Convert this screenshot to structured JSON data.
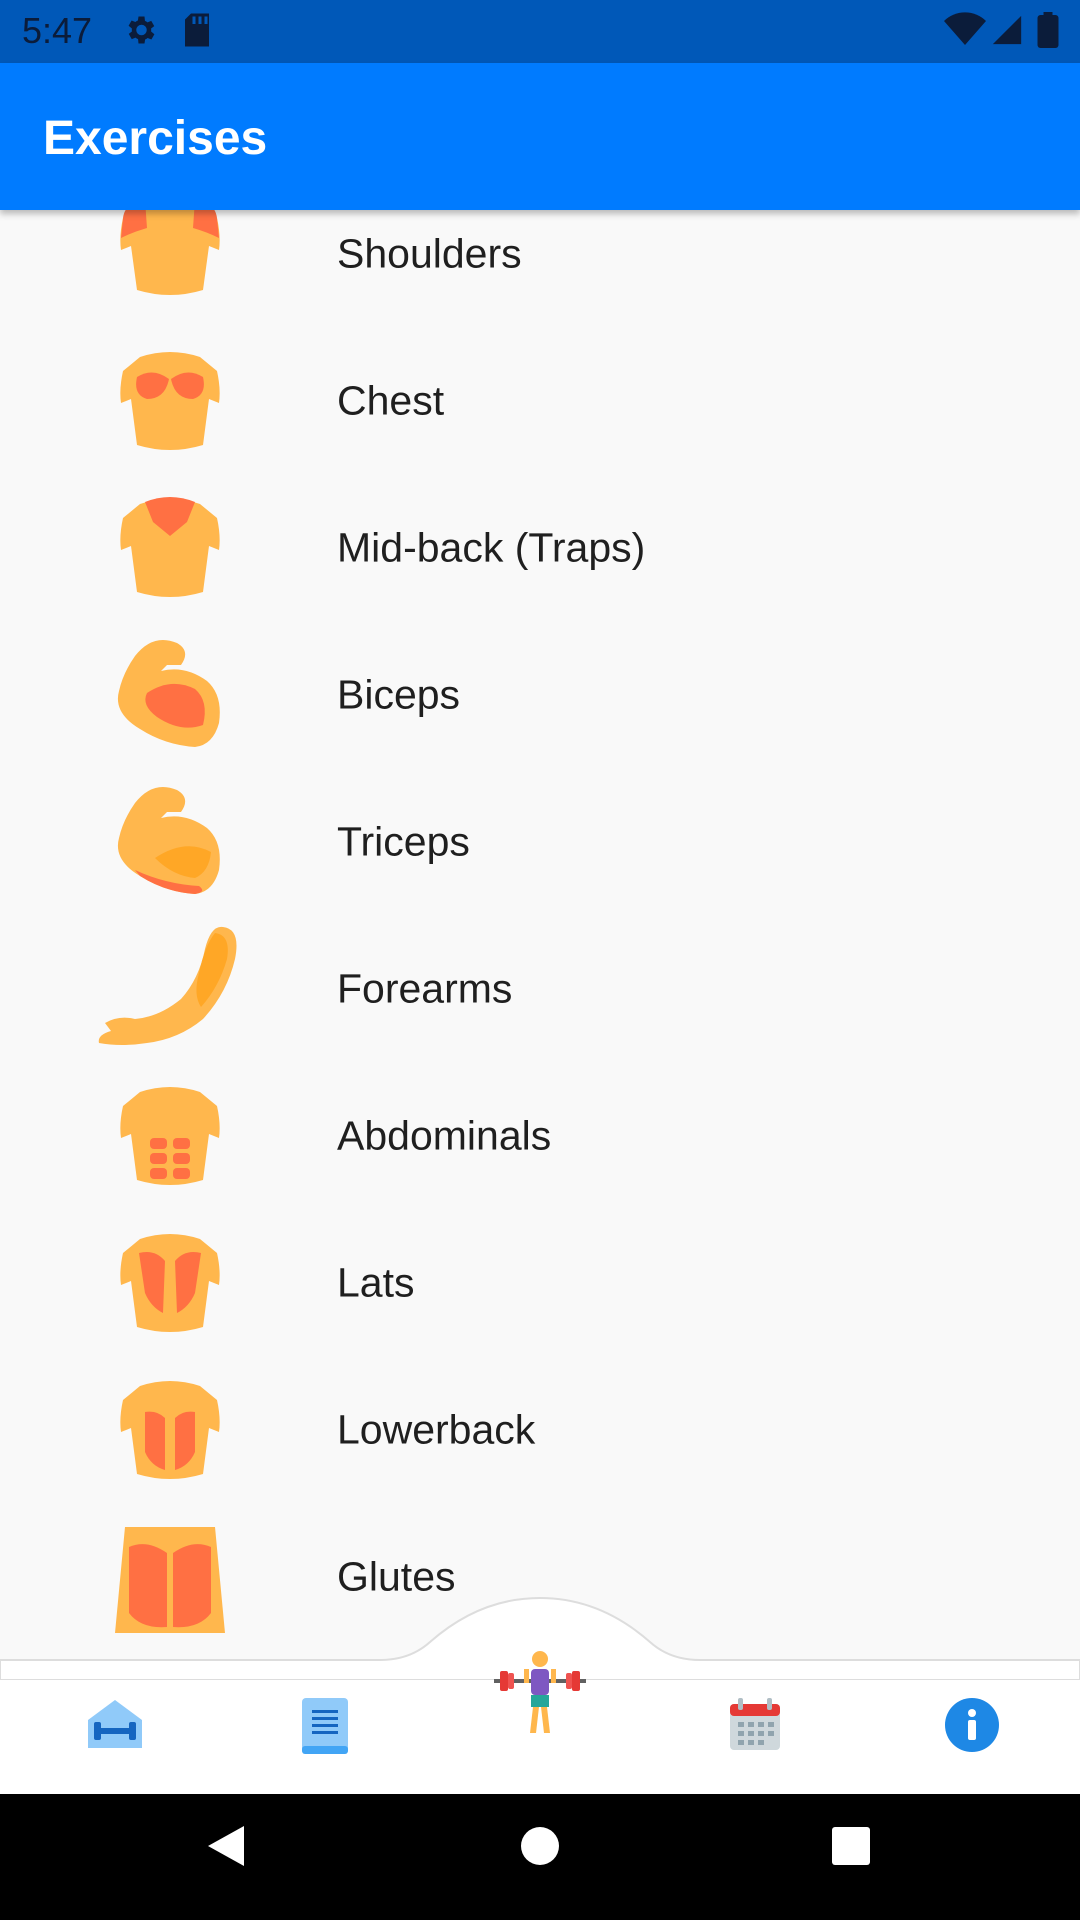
{
  "status_bar": {
    "time": "5:47",
    "icons": [
      "gear-icon",
      "sd-card-icon",
      "wifi-icon",
      "signal-icon",
      "battery-icon"
    ]
  },
  "app_bar": {
    "title": "Exercises"
  },
  "exercises": [
    {
      "label": "Shoulders",
      "icon": "shoulders-icon"
    },
    {
      "label": "Chest",
      "icon": "chest-icon"
    },
    {
      "label": "Mid-back (Traps)",
      "icon": "traps-icon"
    },
    {
      "label": "Biceps",
      "icon": "biceps-icon"
    },
    {
      "label": "Triceps",
      "icon": "triceps-icon"
    },
    {
      "label": "Forearms",
      "icon": "forearm-icon"
    },
    {
      "label": "Abdominals",
      "icon": "abs-icon"
    },
    {
      "label": "Lats",
      "icon": "lats-icon"
    },
    {
      "label": "Lowerback",
      "icon": "lowerback-icon"
    },
    {
      "label": "Glutes",
      "icon": "glutes-icon"
    }
  ],
  "bottom_nav": {
    "items": [
      "home-gym-icon",
      "notes-list-icon",
      "weightlifter-icon",
      "calendar-icon",
      "info-icon"
    ],
    "active": "weightlifter-icon"
  },
  "colors": {
    "status_bar": "#0058b8",
    "app_bar": "#007bff",
    "skin": "#ffb74d",
    "muscle": "#ff7043",
    "info_blue": "#1e88e5"
  }
}
